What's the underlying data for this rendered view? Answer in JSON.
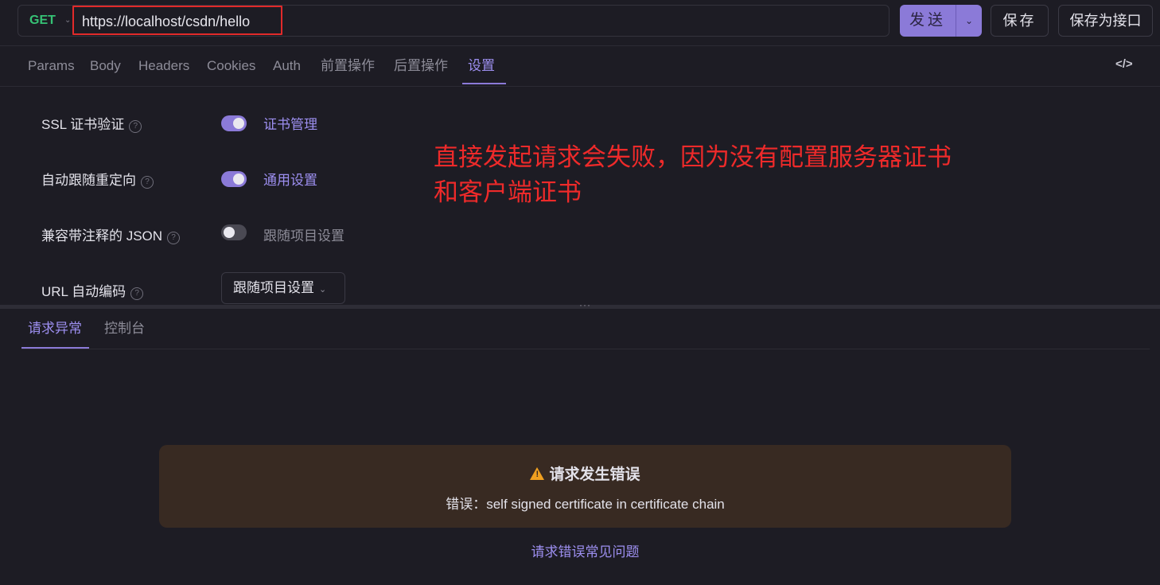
{
  "request": {
    "method": "GET",
    "url": "https://localhost/csdn/hello"
  },
  "toolbar": {
    "send_label": "发送",
    "save_label": "保存",
    "save_as_label": "保存为接口"
  },
  "tabs": [
    {
      "label": "Params"
    },
    {
      "label": "Body"
    },
    {
      "label": "Headers"
    },
    {
      "label": "Cookies"
    },
    {
      "label": "Auth"
    },
    {
      "label": "前置操作"
    },
    {
      "label": "后置操作"
    },
    {
      "label": "设置"
    }
  ],
  "active_tab": "设置",
  "settings": [
    {
      "label": "SSL 证书验证",
      "state": "on",
      "link": "证书管理"
    },
    {
      "label": "自动跟随重定向",
      "state": "on",
      "link": "通用设置"
    },
    {
      "label": "兼容带注释的 JSON",
      "state": "off",
      "link": "跟随项目设置"
    },
    {
      "label": "URL 自动编码",
      "select_value": "跟随项目设置"
    }
  ],
  "annotation": {
    "line1": "直接发起请求会失败，因为没有配置服务器证书",
    "line2": "和客户端证书"
  },
  "bottom_tabs": [
    {
      "label": "请求异常"
    },
    {
      "label": "控制台"
    }
  ],
  "error": {
    "title": "请求发生错误",
    "message": "错误：self signed certificate in certificate chain",
    "faq_link": "请求错误常见问题"
  },
  "colors": {
    "accent": "#8b7ad8",
    "method_get": "#36c275",
    "annotation": "#ee2a2a",
    "error_bg": "#382a22",
    "warning": "#f0a020"
  }
}
